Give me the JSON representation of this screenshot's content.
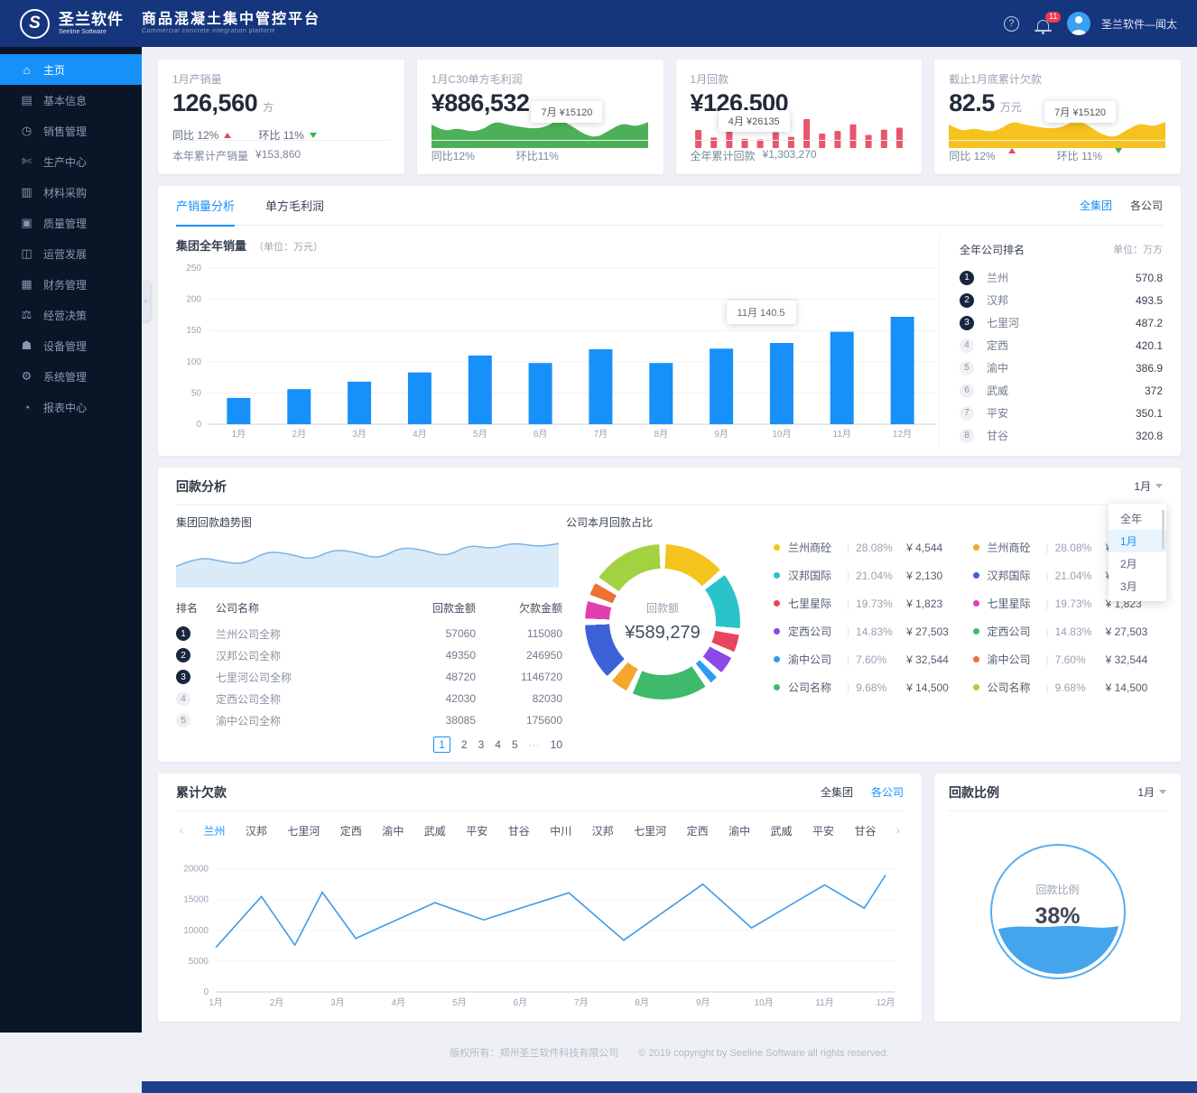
{
  "header": {
    "logo_cn": "圣兰软件",
    "logo_en": "Seeline Software",
    "title": "商品混凝土集中管控平台",
    "subtitle": "Commercial concrete integration platform",
    "help_icon": "?",
    "notification_count": "11",
    "username": "圣兰软件—闻太"
  },
  "sidebar": {
    "active_index": 0,
    "items": [
      {
        "key": "home",
        "label": "主页",
        "glyph": "⌂"
      },
      {
        "key": "basic-info",
        "label": "基本信息",
        "glyph": "▤"
      },
      {
        "key": "sales",
        "label": "销售管理",
        "glyph": "◷"
      },
      {
        "key": "production",
        "label": "生产中心",
        "glyph": "✄"
      },
      {
        "key": "purchase",
        "label": "材料采购",
        "glyph": "▥"
      },
      {
        "key": "quality",
        "label": "质量管理",
        "glyph": "▣"
      },
      {
        "key": "operations",
        "label": "运营发展",
        "glyph": "◫"
      },
      {
        "key": "finance",
        "label": "财务管理",
        "glyph": "▦"
      },
      {
        "key": "decision",
        "label": "经营决策",
        "glyph": "⚖"
      },
      {
        "key": "equipment",
        "label": "设备管理",
        "glyph": "☗"
      },
      {
        "key": "system",
        "label": "系统管理",
        "glyph": "⚙"
      },
      {
        "key": "report",
        "label": "报表中心",
        "glyph": "◔"
      }
    ]
  },
  "kpi": {
    "volume": {
      "title": "1月产销量",
      "value": "126,560",
      "unit": "方",
      "yoy": "同比 12%",
      "mom": "环比 11%",
      "footer_label": "本年累计产销量",
      "footer_value": "¥153,860"
    },
    "profit": {
      "title": "1月C30单方毛利润",
      "value": "¥886,532",
      "tooltip": "7月  ¥15120",
      "footer_yoy": "同比12%",
      "footer_mom": "环比11%"
    },
    "payment": {
      "title": "1月回款",
      "value": "¥126,500",
      "tooltip": "4月  ¥26135",
      "footer_label": "全年累计回款",
      "footer_value": "¥1,303,270"
    },
    "arrears": {
      "title": "截止1月底累计欠款",
      "value": "82.5",
      "unit": "万元",
      "tooltip": "7月  ¥15120",
      "yoy": "同比 12%",
      "mom": "环比 11%"
    }
  },
  "sales": {
    "tabs": [
      "产销量分析",
      "单方毛利润"
    ],
    "active_tab": 0,
    "scope": [
      "全集团",
      "各公司"
    ],
    "scope_active": 0,
    "chart_title": "集团全年销量",
    "chart_unit": "（单位：万元）",
    "tooltip": "11月  140.5",
    "ranking_title": "全年公司排名",
    "ranking_unit": "单位：万方",
    "ranking": [
      {
        "rank": "1",
        "name": "兰州",
        "value": "570.8"
      },
      {
        "rank": "2",
        "name": "汉邦",
        "value": "493.5"
      },
      {
        "rank": "3",
        "name": "七里河",
        "value": "487.2"
      },
      {
        "rank": "4",
        "name": "定西",
        "value": "420.1"
      },
      {
        "rank": "5",
        "name": "渝中",
        "value": "386.9"
      },
      {
        "rank": "6",
        "name": "武威",
        "value": "372"
      },
      {
        "rank": "7",
        "name": "平安",
        "value": "350.1"
      },
      {
        "rank": "8",
        "name": "甘谷",
        "value": "320.8"
      }
    ]
  },
  "collection": {
    "title": "回款分析",
    "month": "1月",
    "dropdown": [
      "全年",
      "1月",
      "2月",
      "3月"
    ],
    "dropdown_active": 1,
    "trend_title": "集团回款趋势图",
    "table_headers": [
      "排名",
      "公司名称",
      "回款金额",
      "欠款金额"
    ],
    "table_rows": [
      [
        "1",
        "兰州公司全称",
        "57060",
        "115080"
      ],
      [
        "2",
        "汉邦公司全称",
        "49350",
        "246950"
      ],
      [
        "3",
        "七里河公司全称",
        "48720",
        "1146720"
      ],
      [
        "4",
        "定西公司全称",
        "42030",
        "82030"
      ],
      [
        "5",
        "渝中公司全称",
        "38085",
        "175600"
      ]
    ],
    "pagination": [
      "1",
      "2",
      "3",
      "4",
      "5",
      "···",
      "10"
    ],
    "pagination_active": 0,
    "donut_title": "公司本月回款占比",
    "center_label": "回款额",
    "center_value": "¥589,279",
    "legend1": [
      {
        "name": "兰州商砼",
        "pct": "28.08%",
        "amount": "¥ 4,544",
        "color": "#f4c41c"
      },
      {
        "name": "汉邦国际",
        "pct": "21.04%",
        "amount": "¥ 2,130",
        "color": "#2ac3c9"
      },
      {
        "name": "七里星际",
        "pct": "19.73%",
        "amount": "¥ 1,823",
        "color": "#e8455f"
      },
      {
        "name": "定西公司",
        "pct": "14.83%",
        "amount": "¥ 27,503",
        "color": "#8a49e8"
      },
      {
        "name": "渝中公司",
        "pct": "7.60%",
        "amount": "¥ 32,544",
        "color": "#2f9bf4"
      },
      {
        "name": "公司名称",
        "pct": "9.68%",
        "amount": "¥ 14,500",
        "color": "#3fba6c"
      }
    ],
    "legend2": [
      {
        "name": "兰州商砼",
        "pct": "28.08%",
        "amount": "¥ 4,544",
        "color": "#f5a62c"
      },
      {
        "name": "汉邦国际",
        "pct": "21.04%",
        "amount": "¥ 2,130",
        "color": "#3d62d8"
      },
      {
        "name": "七里星际",
        "pct": "19.73%",
        "amount": "¥ 1,823",
        "color": "#e23fae"
      },
      {
        "name": "定西公司",
        "pct": "14.83%",
        "amount": "¥ 27,503",
        "color": "#3fba6c"
      },
      {
        "name": "渝中公司",
        "pct": "7.60%",
        "amount": "¥ 32,544",
        "color": "#f07030"
      },
      {
        "name": "公司名称",
        "pct": "9.68%",
        "amount": "¥ 14,500",
        "color": "#a2d23f"
      }
    ]
  },
  "arrears_section": {
    "title": "累计欠款",
    "scope": [
      "全集团",
      "各公司"
    ],
    "scope_active": 1,
    "prev_arrow": "‹",
    "next_arrow": "›",
    "company_active": 0,
    "company_tabs": [
      "兰州",
      "汉邦",
      "七里河",
      "定西",
      "渝中",
      "武威",
      "平安",
      "甘谷",
      "中川",
      "汉邦",
      "七里河",
      "定西",
      "渝中",
      "武威",
      "平安",
      "甘谷"
    ]
  },
  "ratio_card": {
    "title": "回款比例",
    "month": "1月",
    "gauge_label": "回款比例",
    "gauge_value": "38%"
  },
  "footer": {
    "text": "版权所有：郑州圣兰软件科技有限公司　　© 2019 copyright by Seeline Software all rights reserved."
  },
  "chart_data": {
    "sales_bar": {
      "type": "bar",
      "title": "集团全年销量",
      "unit": "万元",
      "categories": [
        "1月",
        "2月",
        "3月",
        "4月",
        "5月",
        "6月",
        "7月",
        "8月",
        "9月",
        "10月",
        "11月",
        "12月"
      ],
      "values": [
        42,
        56,
        68,
        83,
        110,
        98,
        120,
        98,
        121,
        130,
        148,
        172
      ],
      "ylim": [
        0,
        250
      ],
      "yticks": [
        0,
        50,
        100,
        150,
        200,
        250
      ],
      "color": "#1790fa",
      "tooltip": {
        "month": "11月",
        "value": 140.5
      }
    },
    "mini_profit": {
      "type": "area",
      "values": [
        45,
        30,
        38,
        30,
        34,
        52,
        44,
        40,
        36,
        40,
        56,
        42,
        24,
        18,
        34,
        48,
        40,
        50
      ],
      "color": "#4cb058"
    },
    "mini_payment": {
      "type": "bar",
      "values": [
        55,
        32,
        50,
        28,
        26,
        48,
        34,
        88,
        44,
        52,
        72,
        40,
        56,
        62
      ],
      "color": "#e7566c"
    },
    "mini_arrears": {
      "type": "area",
      "values": [
        45,
        30,
        38,
        30,
        34,
        52,
        44,
        40,
        36,
        40,
        56,
        42,
        24,
        18,
        34,
        48,
        40,
        50
      ],
      "color": "#f6c21e"
    },
    "trend": {
      "type": "area",
      "values": [
        35,
        52,
        44,
        38,
        62,
        58,
        46,
        66,
        60,
        48,
        70,
        64,
        52,
        74,
        66,
        78,
        70,
        76
      ],
      "color": "#d9eaf8",
      "line": "#7ab4e6"
    },
    "donut": {
      "type": "pie",
      "segments": [
        {
          "color": "#f4c41c",
          "pct": 14
        },
        {
          "color": "#2ac3c9",
          "pct": 13
        },
        {
          "color": "#e8455f",
          "pct": 5
        },
        {
          "color": "#8a49e8",
          "pct": 5
        },
        {
          "color": "#2f9bf4",
          "pct": 3
        },
        {
          "color": "#3fba6c",
          "pct": 17
        },
        {
          "color": "#f5a62c",
          "pct": 5
        },
        {
          "color": "#3d62d8",
          "pct": 13
        },
        {
          "color": "#e23fae",
          "pct": 5
        },
        {
          "color": "#f07030",
          "pct": 4
        },
        {
          "color": "#a2d23f",
          "pct": 16
        }
      ]
    },
    "arrears_line": {
      "type": "line",
      "x": [
        1,
        1.75,
        2.3,
        2.75,
        3.3,
        4.6,
        5.4,
        6.8,
        7.7,
        9,
        9.8,
        11,
        11.65,
        12
      ],
      "values": [
        7200,
        15500,
        7600,
        16200,
        8700,
        14500,
        11700,
        16100,
        8400,
        17500,
        10400,
        17400,
        13600,
        19000
      ],
      "categories": [
        "1月",
        "2月",
        "3月",
        "4月",
        "5月",
        "6月",
        "7月",
        "8月",
        "9月",
        "10月",
        "11月",
        "12月"
      ],
      "yticks": [
        0,
        5000,
        10000,
        15000,
        20000
      ],
      "color": "#3d9be9"
    },
    "gauge": {
      "type": "gauge",
      "value": 38,
      "color": "#45a5ec"
    }
  }
}
